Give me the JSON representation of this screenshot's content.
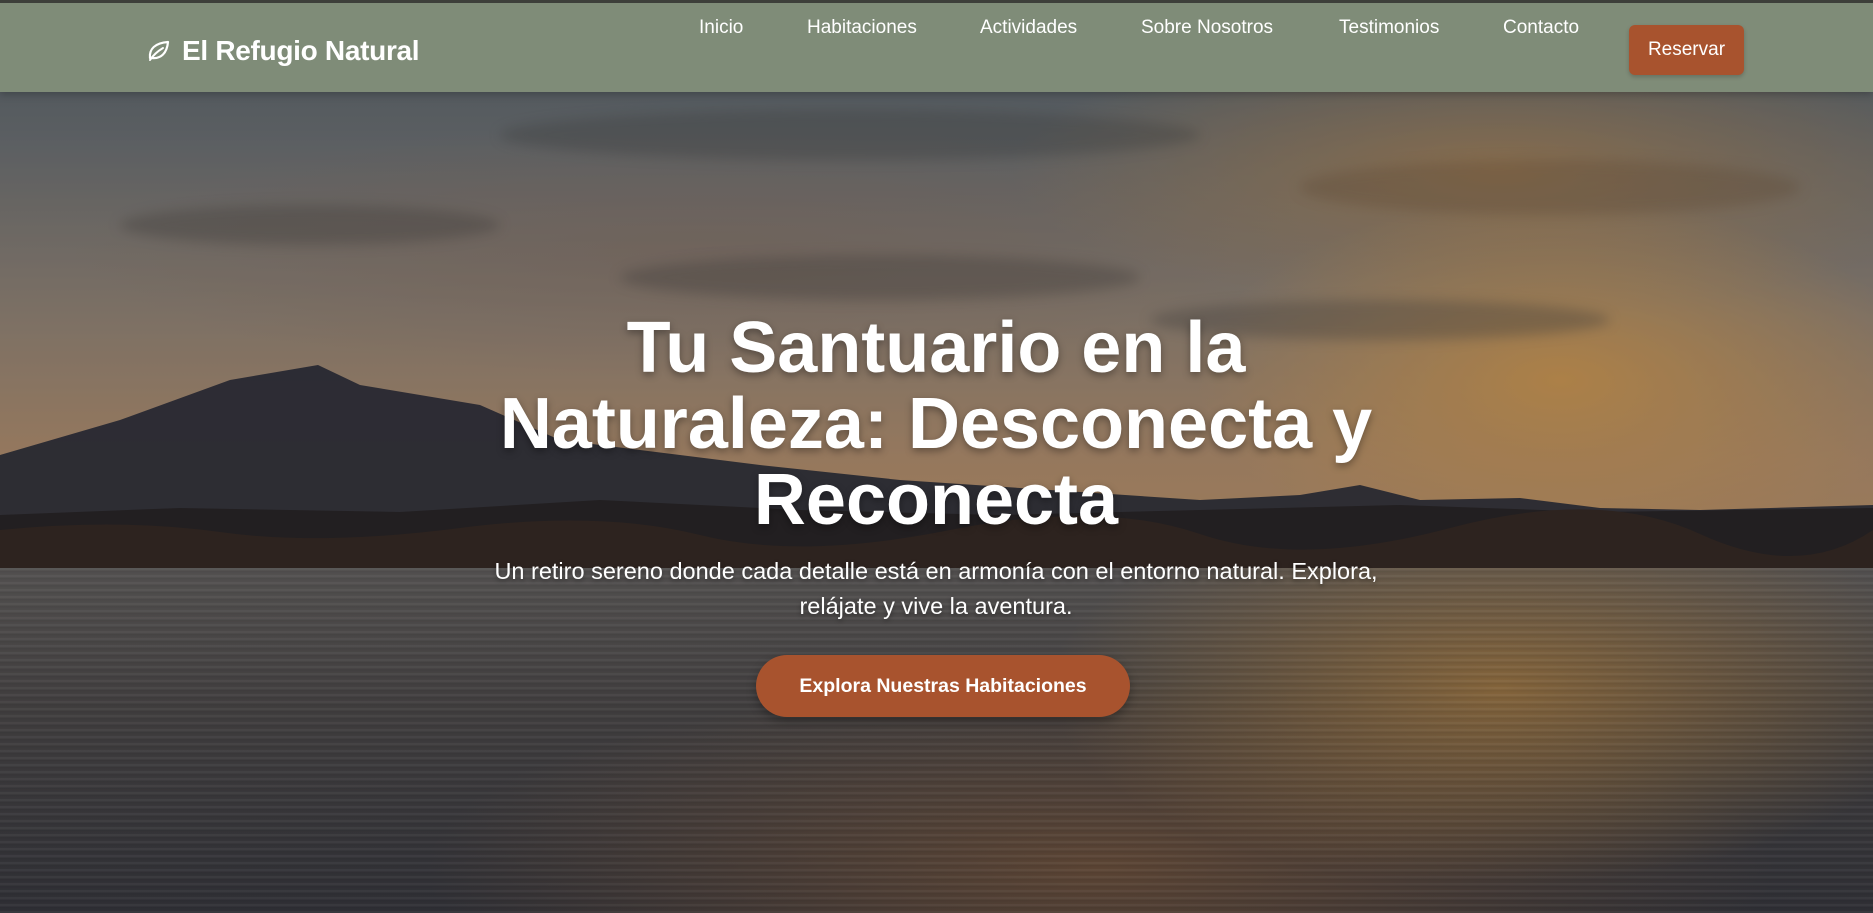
{
  "navbar": {
    "brand": "El Refugio Natural",
    "links": [
      "Inicio",
      "Habitaciones",
      "Actividades",
      "Sobre Nosotros",
      "Testimonios",
      "Contacto"
    ],
    "reserve_label": "Reservar"
  },
  "hero": {
    "title": "Tu Santuario en la Naturaleza: Desconecta y Reconecta",
    "subtitle": "Un retiro sereno donde cada detalle está en armonía con el entorno natural. Explora, relájate y vive la aventura.",
    "cta_label": "Explora Nuestras Habitaciones"
  },
  "icons": {
    "brand": "leaf-icon"
  },
  "colors": {
    "navbar": "#7f8c78",
    "accent": "#a8532e",
    "text": "#ffffff"
  }
}
